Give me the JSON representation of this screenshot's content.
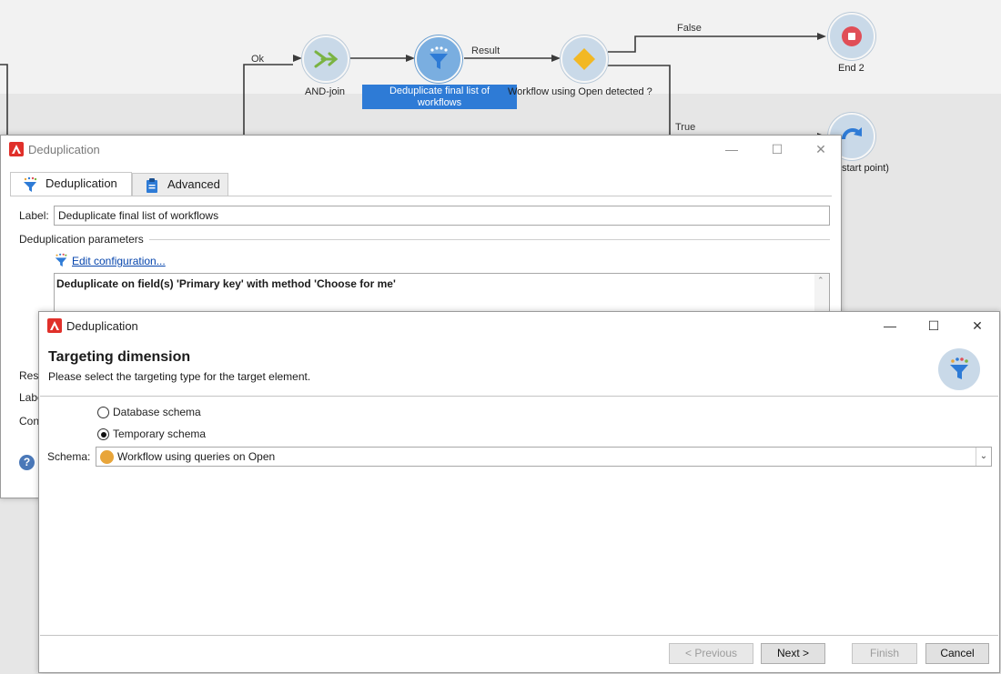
{
  "workflow": {
    "nodes": {
      "and_join": "AND-join",
      "dedup_line1": "Deduplicate final list of",
      "dedup_line2": "workflows",
      "test": "Workflow using Open detected ?",
      "end2": "End 2",
      "start_point": "start point)"
    },
    "edge_labels": {
      "ok": "Ok",
      "result": "Result",
      "false": "False",
      "true": "True"
    }
  },
  "back_window": {
    "title": "Deduplication",
    "tabs": [
      {
        "label": "Deduplication"
      },
      {
        "label": "Advanced"
      }
    ],
    "label_field": {
      "label": "Label:",
      "value": "Deduplicate final list of workflows"
    },
    "section_title": "Deduplication parameters",
    "edit_link": "Edit configuration...",
    "summary": "Deduplicate on field(s) 'Primary key' with method 'Choose for me'",
    "partial_labels": [
      "Resu",
      "Labe",
      "Con"
    ]
  },
  "front_window": {
    "title": "Deduplication",
    "heading": "Targeting dimension",
    "subheading": "Please select the targeting type for the target element.",
    "options": [
      {
        "label": "Database schema",
        "checked": false
      },
      {
        "label": "Temporary schema",
        "checked": true
      }
    ],
    "schema": {
      "label": "Schema:",
      "value": "Workflow using queries on Open",
      "icon_color": "#e8a53a"
    },
    "buttons": {
      "previous": "< Previous",
      "next": "Next >",
      "finish": "Finish",
      "cancel": "Cancel"
    }
  },
  "colors": {
    "accent": "#2e7bd6",
    "node": "#c9d9e8",
    "app_logo": "#e0302a"
  }
}
